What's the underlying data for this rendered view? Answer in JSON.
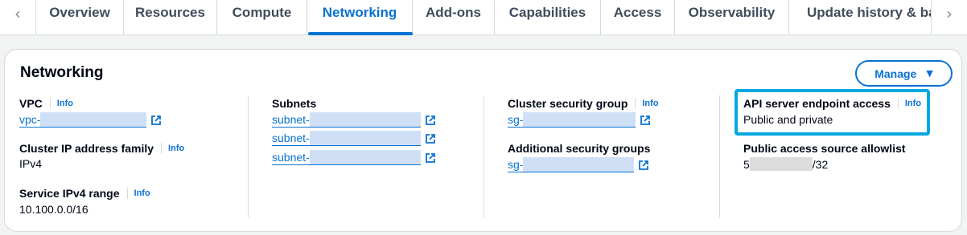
{
  "tabs": {
    "prev_arrow": "‹",
    "next_arrow": "›",
    "items": [
      {
        "label": "Overview"
      },
      {
        "label": "Resources"
      },
      {
        "label": "Compute"
      },
      {
        "label": "Networking"
      },
      {
        "label": "Add-ons"
      },
      {
        "label": "Capabilities"
      },
      {
        "label": "Access"
      },
      {
        "label": "Observability"
      },
      {
        "label": "Update history & bac"
      }
    ],
    "active": "Networking"
  },
  "card": {
    "title": "Networking",
    "manage_label": "Manage",
    "info_label": "Info",
    "col1": {
      "vpc_label": "VPC",
      "vpc_link_prefix": "vpc-",
      "ip_family_label": "Cluster IP address family",
      "ip_family_value": "IPv4",
      "service_range_label": "Service IPv4 range",
      "service_range_value": "10.100.0.0/16"
    },
    "col2": {
      "subnets_label": "Subnets",
      "subnets": [
        "subnet-",
        "subnet-",
        "subnet-"
      ]
    },
    "col3": {
      "csg_label": "Cluster security group",
      "csg_link_prefix": "sg-",
      "asg_label": "Additional security groups",
      "asg_link_prefix": "sg-"
    },
    "col4": {
      "endpoint_label": "API server endpoint access",
      "endpoint_value": "Public and private",
      "allowlist_label": "Public access source allowlist",
      "allowlist_prefix": "5",
      "allowlist_suffix": "/32"
    }
  },
  "colors": {
    "accent": "#0972d3",
    "highlight": "#00a8e1"
  },
  "icons": {
    "external": "external-link-icon",
    "caret": "caret-down-icon"
  }
}
